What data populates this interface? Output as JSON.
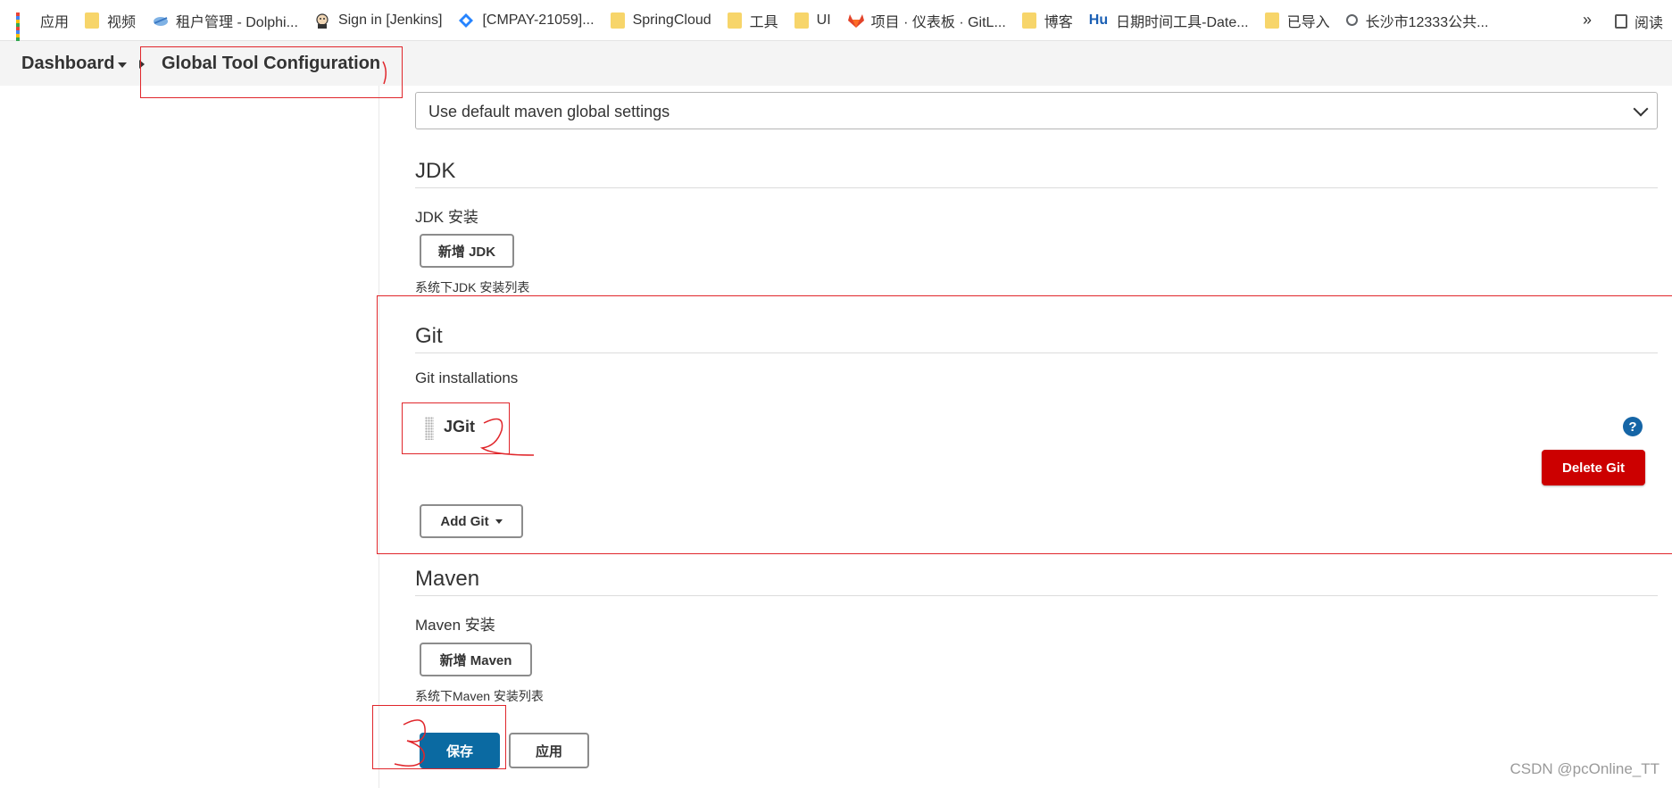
{
  "bookmarks": [
    {
      "label": "应用",
      "icon": "apps-grid-icon"
    },
    {
      "label": "视频",
      "icon": "folder-icon"
    },
    {
      "label": "租户管理 - Dolphi...",
      "icon": "cloud-icon"
    },
    {
      "label": "Sign in [Jenkins]",
      "icon": "jenkins-icon"
    },
    {
      "label": "[CMPAY-21059]...",
      "icon": "jira-icon"
    },
    {
      "label": "SpringCloud",
      "icon": "folder-icon"
    },
    {
      "label": "工具",
      "icon": "folder-icon"
    },
    {
      "label": "UI",
      "icon": "folder-icon"
    },
    {
      "label": "项目 · 仪表板 · GitL...",
      "icon": "gitlab-icon"
    },
    {
      "label": "博客",
      "icon": "folder-icon"
    },
    {
      "label": "日期时间工具-Date...",
      "icon": "hutool-icon",
      "icon_text": "Hu"
    },
    {
      "label": "已导入",
      "icon": "folder-icon"
    },
    {
      "label": "长沙市12333公共...",
      "icon": "globe-icon"
    }
  ],
  "bookmarks_more": "»",
  "reading_list": "阅读",
  "breadcrumb": {
    "dashboard": "Dashboard",
    "current": "Global Tool Configuration"
  },
  "maven_settings_select": "Use default maven global settings",
  "jdk": {
    "title": "JDK",
    "label": "JDK 安装",
    "add_button": "新增 JDK",
    "hint": "系统下JDK 安装列表"
  },
  "git": {
    "title": "Git",
    "label": "Git installations",
    "item": "JGit",
    "help": "?",
    "delete_button": "Delete Git",
    "add_button": "Add Git"
  },
  "maven": {
    "title": "Maven",
    "label": "Maven 安装",
    "add_button": "新增 Maven",
    "hint": "系统下Maven 安装列表"
  },
  "actions": {
    "save": "保存",
    "apply": "应用"
  },
  "watermark": "CSDN @pcOnline_TT",
  "colors": {
    "danger": "#cc0000",
    "primary": "#0b6aa2",
    "annotation": "#e0262b",
    "help": "#1565a6"
  }
}
